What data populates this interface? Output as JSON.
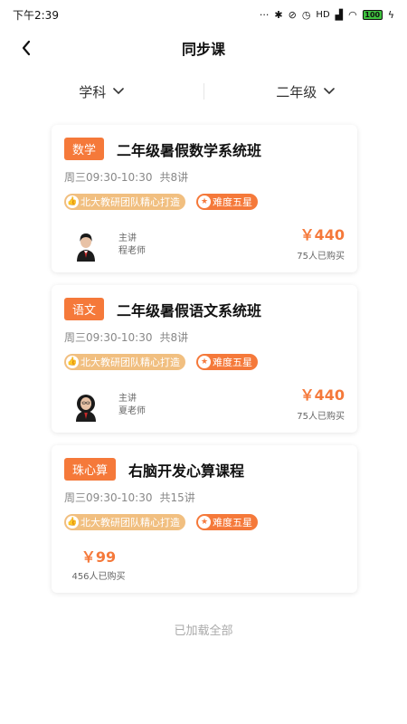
{
  "status_bar": {
    "time": "下午2:39",
    "signal_label": "HD",
    "battery": "100"
  },
  "header": {
    "title": "同步课"
  },
  "filters": [
    {
      "label": "学科"
    },
    {
      "label": "二年级"
    }
  ],
  "courses": [
    {
      "tag": "数学",
      "title": "二年级暑假数学系统班",
      "time": "周三09:30-10:30",
      "lessons": "共8讲",
      "badge_team": "北大教研团队精心打造",
      "badge_level": "难度五星",
      "teacher_role": "主讲",
      "teacher_name": "程老师",
      "price": "￥440",
      "buyers": "75人已购买"
    },
    {
      "tag": "语文",
      "title": "二年级暑假语文系统班",
      "time": "周三09:30-10:30",
      "lessons": "共8讲",
      "badge_team": "北大教研团队精心打造",
      "badge_level": "难度五星",
      "teacher_role": "主讲",
      "teacher_name": "夏老师",
      "price": "￥440",
      "buyers": "75人已购买"
    },
    {
      "tag": "珠心算",
      "title": "右脑开发心算课程",
      "time": "周三09:30-10:30",
      "lessons": "共15讲",
      "badge_team": "北大教研团队精心打造",
      "badge_level": "难度五星",
      "price": "￥99",
      "buyers": "456人已购买"
    }
  ],
  "footer": {
    "note": "已加载全部"
  },
  "colors": {
    "accent": "#f5793a",
    "badge_team": "#f1bf80"
  }
}
